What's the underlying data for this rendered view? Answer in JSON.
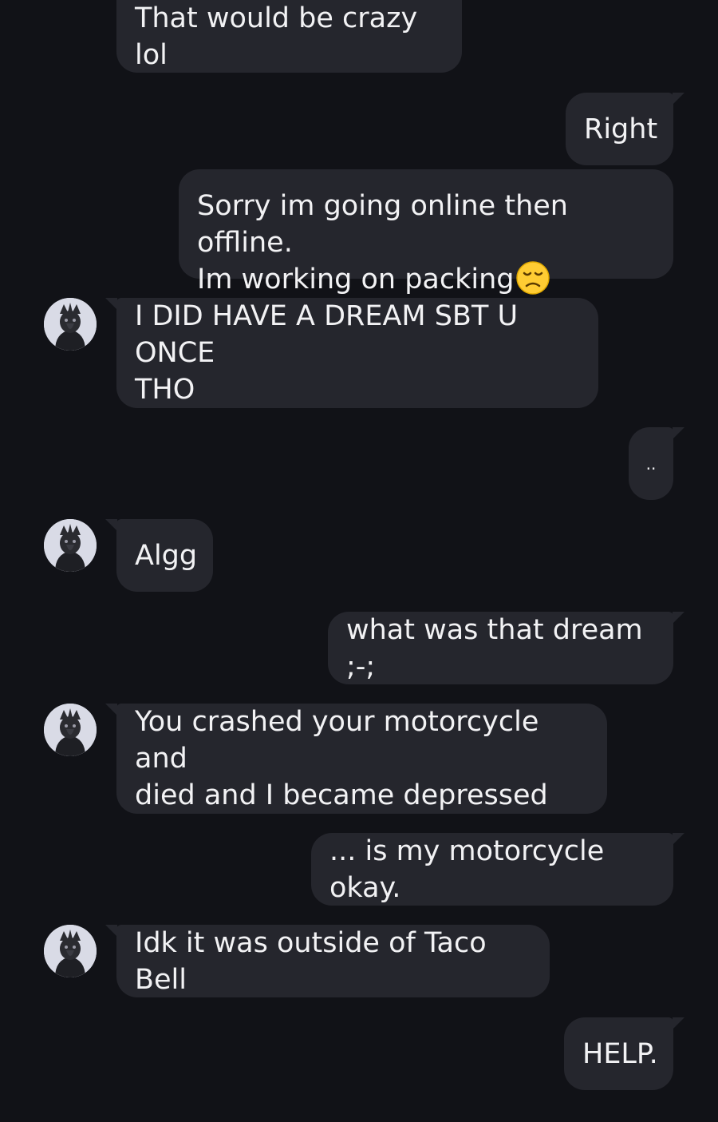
{
  "messages": [
    {
      "id": "m1",
      "sender": "them",
      "text": "That would be crazy lol"
    },
    {
      "id": "m2",
      "sender": "me",
      "text": "Right"
    },
    {
      "id": "m3",
      "sender": "me",
      "text": "Sorry im going online then offline.\nIm working on packing",
      "emoji": "disappointed-face"
    },
    {
      "id": "m4",
      "sender": "them",
      "text": "I DID HAVE A DREAM SBT U ONCE\nTHO"
    },
    {
      "id": "m5",
      "sender": "me",
      "text": ".."
    },
    {
      "id": "m6",
      "sender": "them",
      "text": "Algg"
    },
    {
      "id": "m7",
      "sender": "me",
      "text": "what was that dream ;-;"
    },
    {
      "id": "m8",
      "sender": "them",
      "text": "You crashed your motorcycle and\ndied and I became depressed"
    },
    {
      "id": "m9",
      "sender": "me",
      "text": "... is my motorcycle okay."
    },
    {
      "id": "m10",
      "sender": "them",
      "text": "Idk it was outside of Taco Bell"
    },
    {
      "id": "m11",
      "sender": "me",
      "text": "HELP."
    }
  ],
  "colors": {
    "background": "#111217",
    "bubble": "#25262d",
    "text": "#f2f2f4",
    "avatar_bg": "#d9dbe6"
  }
}
